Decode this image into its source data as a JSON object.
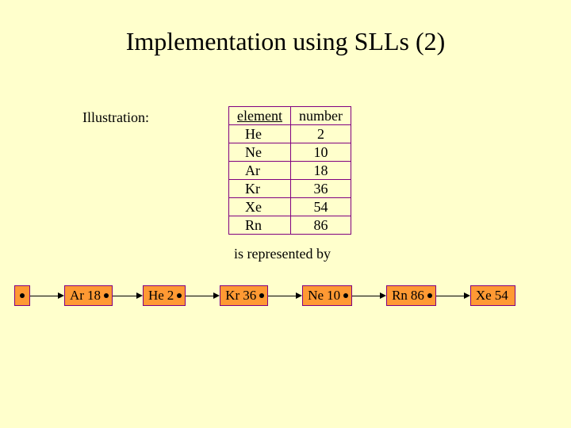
{
  "title": "Implementation using SLLs (2)",
  "illustration_label": "Illustration:",
  "table": {
    "headers": {
      "element": "element",
      "number": "number"
    },
    "rows": [
      {
        "el": "He",
        "num": "2"
      },
      {
        "el": "Ne",
        "num": "10"
      },
      {
        "el": "Ar",
        "num": "18"
      },
      {
        "el": "Kr",
        "num": "36"
      },
      {
        "el": "Xe",
        "num": "54"
      },
      {
        "el": "Rn",
        "num": "86"
      }
    ]
  },
  "represented_by": "is represented by",
  "sll": {
    "nodes": [
      {
        "el": "Ar",
        "num": "18",
        "arrow_len": 30
      },
      {
        "el": "He",
        "num": "2",
        "arrow_len": 35
      },
      {
        "el": "Kr",
        "num": "36",
        "arrow_len": 35
      },
      {
        "el": "Ne",
        "num": "10",
        "arrow_len": 35
      },
      {
        "el": "Rn",
        "num": "86",
        "arrow_len": 35
      },
      {
        "el": "Xe",
        "num": "54",
        "arrow_len": 0
      }
    ],
    "head_arrow_len": 35
  }
}
